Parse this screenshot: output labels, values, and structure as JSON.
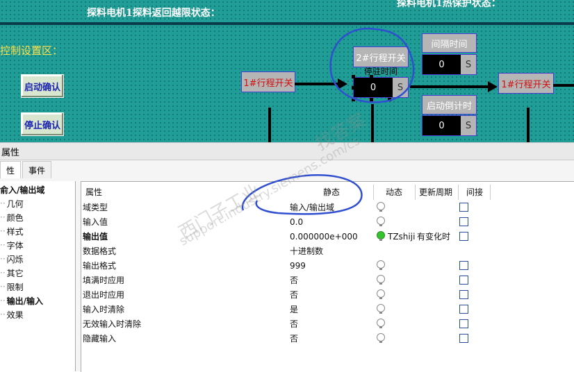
{
  "canvas": {
    "title_left": "探料电机1探料返回越限状态：",
    "title_right": "探料电机1热保护状态：",
    "control_area_label": "控制设置区：",
    "start_confirm_label": "启动确认",
    "stop_confirm_label": "停止确认",
    "switch1_label": "1#行程开关",
    "switch2_label": "2#行程开关",
    "stop_time_label": "停驻时间",
    "stop_time_value": "0",
    "stop_time_unit": "S",
    "interval_label": "间隔时间",
    "interval_value": "0",
    "interval_unit": "S",
    "countdown_label": "启动倒计时",
    "countdown_value": "0",
    "countdown_unit": "S",
    "switch_right_label": "1#行程开关"
  },
  "properties": {
    "header_title": "属性",
    "tabs": [
      "性",
      "事件"
    ],
    "tree_items": [
      "俞入/输出域",
      "几何",
      "颜色",
      "样式",
      "字体",
      "闪烁",
      "其它",
      "限制",
      "输出/输入",
      "效果"
    ],
    "columns": [
      "属性",
      "静态",
      "动态",
      "更新周期",
      "间接"
    ],
    "rows": [
      {
        "name": "域类型",
        "static": "输入/输出域",
        "dynamic": "",
        "cycle": "",
        "bulb": "off",
        "checkbox": true,
        "bold": false
      },
      {
        "name": "输入值",
        "static": "0.0",
        "dynamic": "",
        "cycle": "",
        "bulb": "off",
        "checkbox": true,
        "bold": false
      },
      {
        "name": "输出值",
        "static": "0.000000e+000",
        "dynamic": "TZshiji",
        "cycle": "有变化时",
        "bulb": "on",
        "checkbox": true,
        "bold": true
      },
      {
        "name": "数据格式",
        "static": "十进制数",
        "dynamic": "",
        "cycle": "",
        "bulb": "none",
        "checkbox": false,
        "bold": false
      },
      {
        "name": "输出格式",
        "static": "999",
        "dynamic": "",
        "cycle": "",
        "bulb": "off",
        "checkbox": true,
        "bold": false
      },
      {
        "name": "填满时应用",
        "static": "否",
        "dynamic": "",
        "cycle": "",
        "bulb": "off",
        "checkbox": true,
        "bold": false
      },
      {
        "name": "退出时应用",
        "static": "否",
        "dynamic": "",
        "cycle": "",
        "bulb": "off",
        "checkbox": true,
        "bold": false
      },
      {
        "name": "输入时清除",
        "static": "是",
        "dynamic": "",
        "cycle": "",
        "bulb": "off",
        "checkbox": true,
        "bold": false
      },
      {
        "name": "无效输入时清除",
        "static": "否",
        "dynamic": "",
        "cycle": "",
        "bulb": "off",
        "checkbox": true,
        "bold": false
      },
      {
        "name": "隐藏输入",
        "static": "否",
        "dynamic": "",
        "cycle": "",
        "bulb": "off",
        "checkbox": true,
        "bold": false
      }
    ]
  },
  "watermarks": [
    "西门子工业",
    "support.industry.siemens.com/cs",
    "找答案"
  ],
  "colors": {
    "canvas_bg": "#1f9d96",
    "annotation_stroke": "#2f4fd0",
    "label_yellow": "#ffe14d",
    "switch_text_red": "#d21010"
  },
  "icons": [
    "light-bulb-icon",
    "checkbox-icon",
    "tree-dots-icon"
  ]
}
